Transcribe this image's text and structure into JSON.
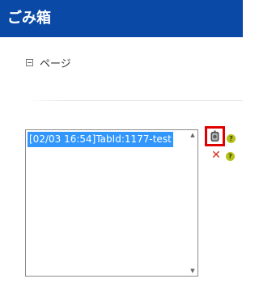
{
  "header": {
    "title": "ごみ箱"
  },
  "tree": {
    "node_label": "ページ"
  },
  "recycle_list": {
    "items": [
      "[02/03 16:54]TabId:1177-test"
    ],
    "selected_index": 0
  },
  "actions": {
    "restore_icon": "restore-icon",
    "delete_icon": "delete-icon",
    "help_symbol": "?",
    "delete_symbol": "✕"
  },
  "colors": {
    "header_bg": "#0a4aa6",
    "selection": "#3297fd",
    "highlight_border": "#e00000",
    "delete": "#d22d1d",
    "help": "#b3c21a"
  }
}
